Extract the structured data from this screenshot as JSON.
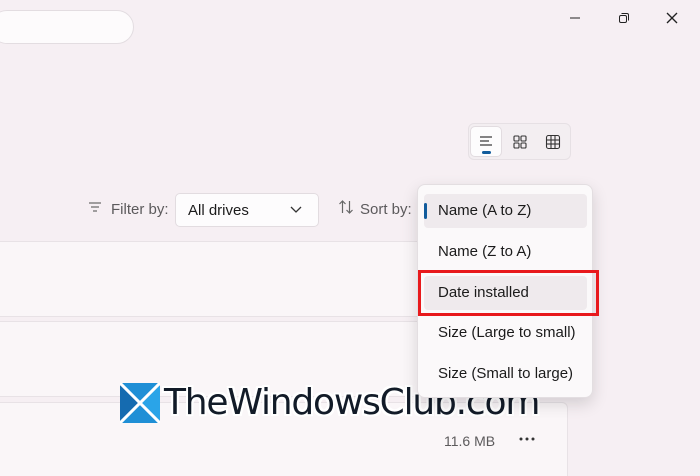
{
  "window": {
    "controls": {
      "minimize_icon": "minimize-icon",
      "maximize_icon": "restore-icon",
      "close_icon": "close-icon"
    }
  },
  "search": {
    "value": ""
  },
  "view_toggle": {
    "options": [
      "list-view-icon",
      "grid-view-icon",
      "table-view-icon"
    ],
    "active": "list-view-icon",
    "accent": "#125c9c"
  },
  "filter": {
    "label": "Filter by:",
    "selected": "All drives"
  },
  "sort": {
    "label": "Sort by:",
    "menu": [
      {
        "label": "Name (A to Z)",
        "selected": true
      },
      {
        "label": "Name (Z to A)",
        "selected": false
      },
      {
        "label": "Date installed",
        "selected": false,
        "highlighted": true
      },
      {
        "label": "Size (Large to small)",
        "selected": false
      },
      {
        "label": "Size (Small to large)",
        "selected": false
      }
    ]
  },
  "apps": [
    {
      "size": ""
    },
    {
      "size": ""
    },
    {
      "size": "11.6 MB"
    }
  ],
  "watermark": {
    "text": "TheWindowsClub.com"
  },
  "colors": {
    "background": "#f6eff3",
    "accent": "#125c9c",
    "highlight": "#e8191c"
  }
}
